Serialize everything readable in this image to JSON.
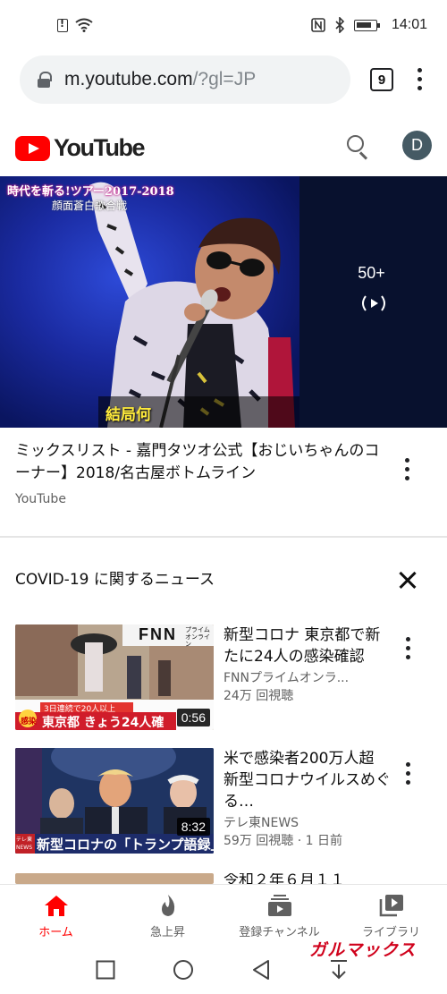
{
  "status_bar": {
    "time": "14:01"
  },
  "browser": {
    "url_host": "m.youtube.com",
    "url_path": "/?gl=JP",
    "tab_count": "9"
  },
  "youtube": {
    "logo_text": "YouTube",
    "avatar_letter": "D"
  },
  "hero_video": {
    "thumbnail_caption_top": "時代を斬る!ツアー2017-2018",
    "thumbnail_caption_sub": "顔面蒼白歌合戦",
    "thumbnail_subtitle": "結局何",
    "playlist_count": "50+",
    "title": "ミックスリスト - 嘉門タツオ公式【おじいちゃんのコーナー】2018/名古屋ボトムライン",
    "channel": "YouTube"
  },
  "news_section": {
    "header": "COVID-19 に関するニュース",
    "items": [
      {
        "title": "新型コロナ 東京都で新たに24人の感染確認",
        "channel": "FNNプライムオンラ...",
        "stats": "24万 回視聴",
        "duration": "0:56",
        "thumb_logo": "FNN",
        "thumb_logo_sub": "プライム オンライン",
        "thumb_banner_small": "3日連続で20人以上",
        "thumb_banner": "東京都 きょう24人確",
        "thumb_tag": "感染"
      },
      {
        "title": "米で感染者200万人超　新型コロナウイルスめぐる…",
        "channel": "テレ東NEWS",
        "stats": "59万 回視聴 · 1 日前",
        "duration": "8:32",
        "thumb_banner": "新型コロナの「トランプ語録」",
        "thumb_tag": "テレ東 NEWS"
      },
      {
        "title": "令和２年６月１１",
        "channel": "",
        "stats": ""
      }
    ]
  },
  "bottom_nav": {
    "items": [
      {
        "label": "ホーム",
        "icon": "home-icon",
        "active": true
      },
      {
        "label": "急上昇",
        "icon": "trending-icon",
        "active": false
      },
      {
        "label": "登録チャンネル",
        "icon": "subscriptions-icon",
        "active": false
      },
      {
        "label": "ライブラリ",
        "icon": "library-icon",
        "active": false
      }
    ]
  },
  "watermark": "ガルマックス",
  "colors": {
    "youtube_red": "#ff0000",
    "text_primary": "#0f0f0f",
    "text_secondary": "#606060",
    "url_bar_bg": "#f1f3f4"
  }
}
